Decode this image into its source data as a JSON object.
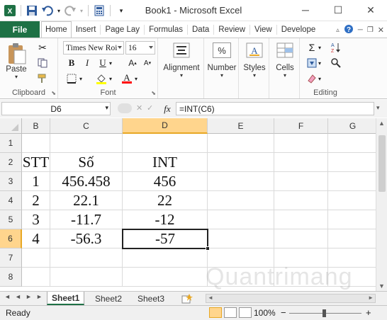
{
  "window": {
    "title": "Book1 - Microsoft Excel",
    "minimize_glyph": "─",
    "maximize_glyph": "☐",
    "close_glyph": "✕"
  },
  "ribbon_tabs": {
    "file": "File",
    "items": [
      "Home",
      "Insert",
      "Page Lay",
      "Formulas",
      "Data",
      "Review",
      "View",
      "Develope"
    ],
    "active_index": 0
  },
  "clipboard": {
    "paste": "Paste",
    "label": "Clipboard"
  },
  "font": {
    "family": "Times New Roi",
    "size": "16",
    "label": "Font",
    "bold": "B",
    "italic": "I",
    "underline": "U",
    "font_color_glyph": "A",
    "fill_color": "#ffff00",
    "font_color": "#ff0000"
  },
  "alignment": {
    "label": "Alignment"
  },
  "number": {
    "label": "Number",
    "glyph": "%"
  },
  "styles": {
    "label": "Styles"
  },
  "cells_group": {
    "label": "Cells"
  },
  "editing": {
    "label": "Editing",
    "sum_glyph": "Σ"
  },
  "formula_bar": {
    "name_box": "D6",
    "fx": "fx",
    "formula": "=INT(C6)"
  },
  "columns": [
    "B",
    "C",
    "D",
    "E",
    "F",
    "G"
  ],
  "selected_column": "D",
  "rows": [
    "1",
    "2",
    "3",
    "4",
    "5",
    "6",
    "7",
    "8"
  ],
  "selected_row": "6",
  "cells": {
    "r2": [
      "STT",
      "Số",
      "INT"
    ],
    "r3": [
      "1",
      "456.458",
      "456"
    ],
    "r4": [
      "2",
      "22.1",
      "22"
    ],
    "r5": [
      "3",
      "-11.7",
      "-12"
    ],
    "r6": [
      "4",
      "-56.3",
      "-57"
    ]
  },
  "sheets": {
    "nav": [
      "◄",
      "◄",
      "►",
      "►"
    ],
    "tabs": [
      "Sheet1",
      "Sheet2",
      "Sheet3"
    ],
    "active": "Sheet1"
  },
  "status": {
    "ready": "Ready",
    "zoom": "100%",
    "zoom_out": "−",
    "zoom_in": "+"
  },
  "watermark": "Quantrimang",
  "colors": {
    "excel_green": "#1e7145",
    "header_selected": "#ffd58d",
    "header_selected_border": "#e8a825"
  }
}
